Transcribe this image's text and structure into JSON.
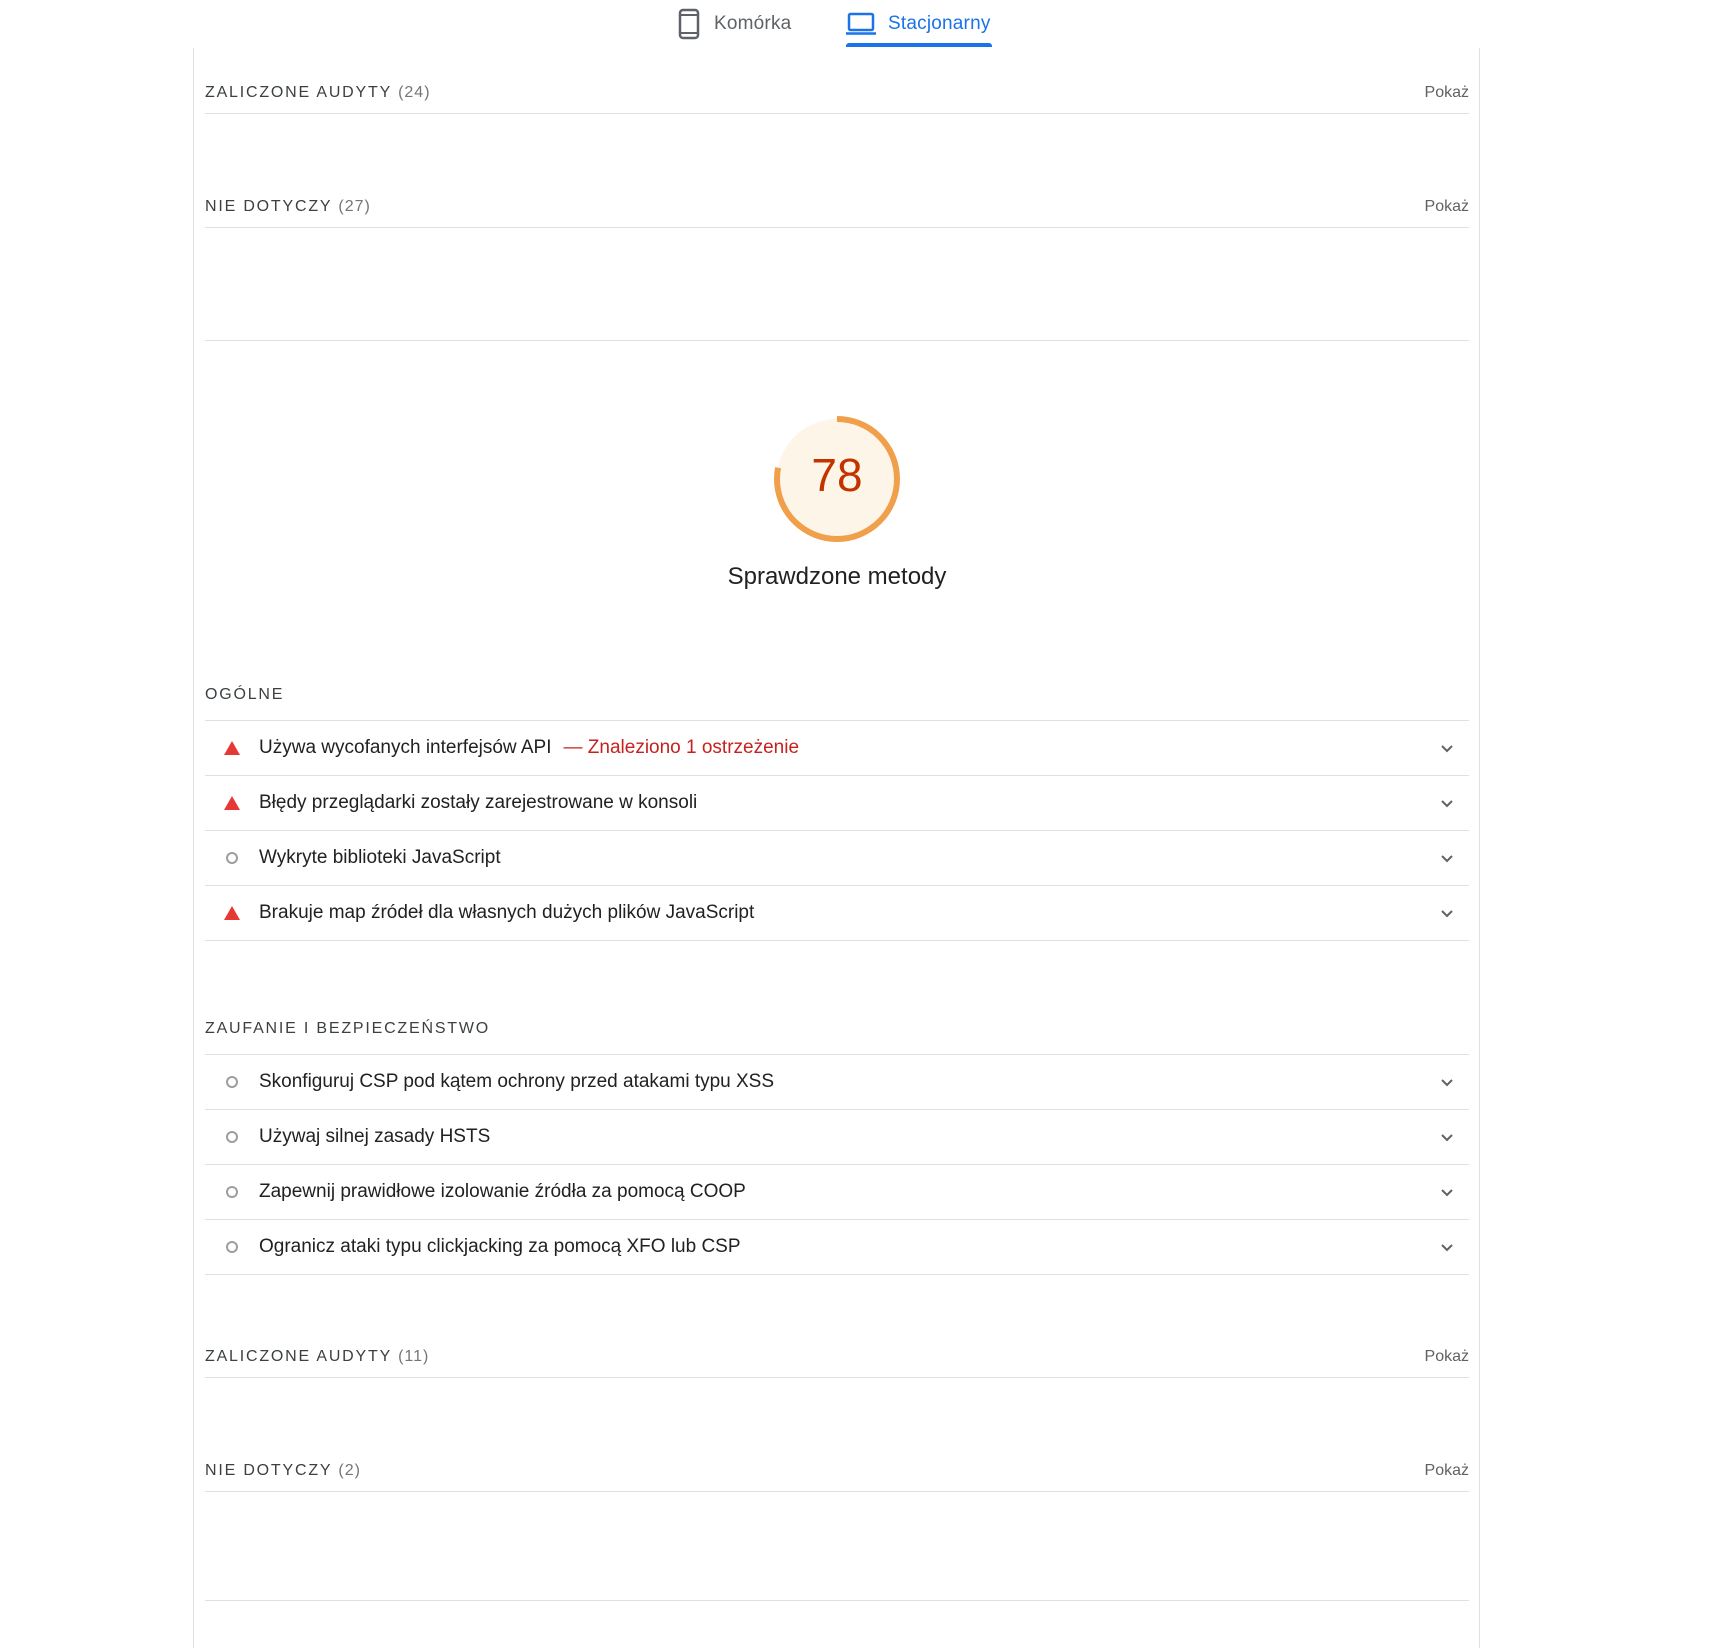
{
  "tabs": {
    "mobile": {
      "label": "Komórka",
      "icon": "phone-icon",
      "active": false
    },
    "desktop": {
      "label": "Stacjonarny",
      "icon": "laptop-icon",
      "active": true
    }
  },
  "colors": {
    "accent": "#1a73e8",
    "score_average": "#f0a04b",
    "score_text": "#c33300",
    "fail": "#e53935",
    "warning_text": "#c5221f"
  },
  "performance_tail": {
    "passed": {
      "title": "ZALICZONE AUDYTY",
      "count": "(24)",
      "show": "Pokaż"
    },
    "not_applicable": {
      "title": "NIE DOTYCZY",
      "count": "(27)",
      "show": "Pokaż"
    }
  },
  "best_practices": {
    "score": "78",
    "score_fraction": 0.78,
    "title": "Sprawdzone metody",
    "groups": [
      {
        "title": "OGÓLNE",
        "audits": [
          {
            "status": "fail",
            "status_icon": "triangle-icon",
            "title": "Używa wycofanych interfejsów API",
            "warning": "— Znaleziono 1 ostrzeżenie"
          },
          {
            "status": "fail",
            "status_icon": "triangle-icon",
            "title": "Błędy przeglądarki zostały zarejestrowane w konsoli"
          },
          {
            "status": "info",
            "status_icon": "circle-icon",
            "title": "Wykryte biblioteki JavaScript"
          },
          {
            "status": "fail",
            "status_icon": "triangle-icon",
            "title": "Brakuje map źródeł dla własnych dużych plików JavaScript"
          }
        ]
      },
      {
        "title": "ZAUFANIE I BEZPIECZEŃSTWO",
        "audits": [
          {
            "status": "info",
            "status_icon": "circle-icon",
            "title": "Skonfiguruj CSP pod kątem ochrony przed atakami typu XSS"
          },
          {
            "status": "info",
            "status_icon": "circle-icon",
            "title": "Używaj silnej zasady HSTS"
          },
          {
            "status": "info",
            "status_icon": "circle-icon",
            "title": "Zapewnij prawidłowe izolowanie źródła za pomocą COOP"
          },
          {
            "status": "info",
            "status_icon": "circle-icon",
            "title": "Ogranicz ataki typu clickjacking za pomocą XFO lub CSP"
          }
        ]
      }
    ],
    "passed": {
      "title": "ZALICZONE AUDYTY",
      "count": "(11)",
      "show": "Pokaż"
    },
    "not_applicable": {
      "title": "NIE DOTYCZY",
      "count": "(2)",
      "show": "Pokaż"
    }
  }
}
